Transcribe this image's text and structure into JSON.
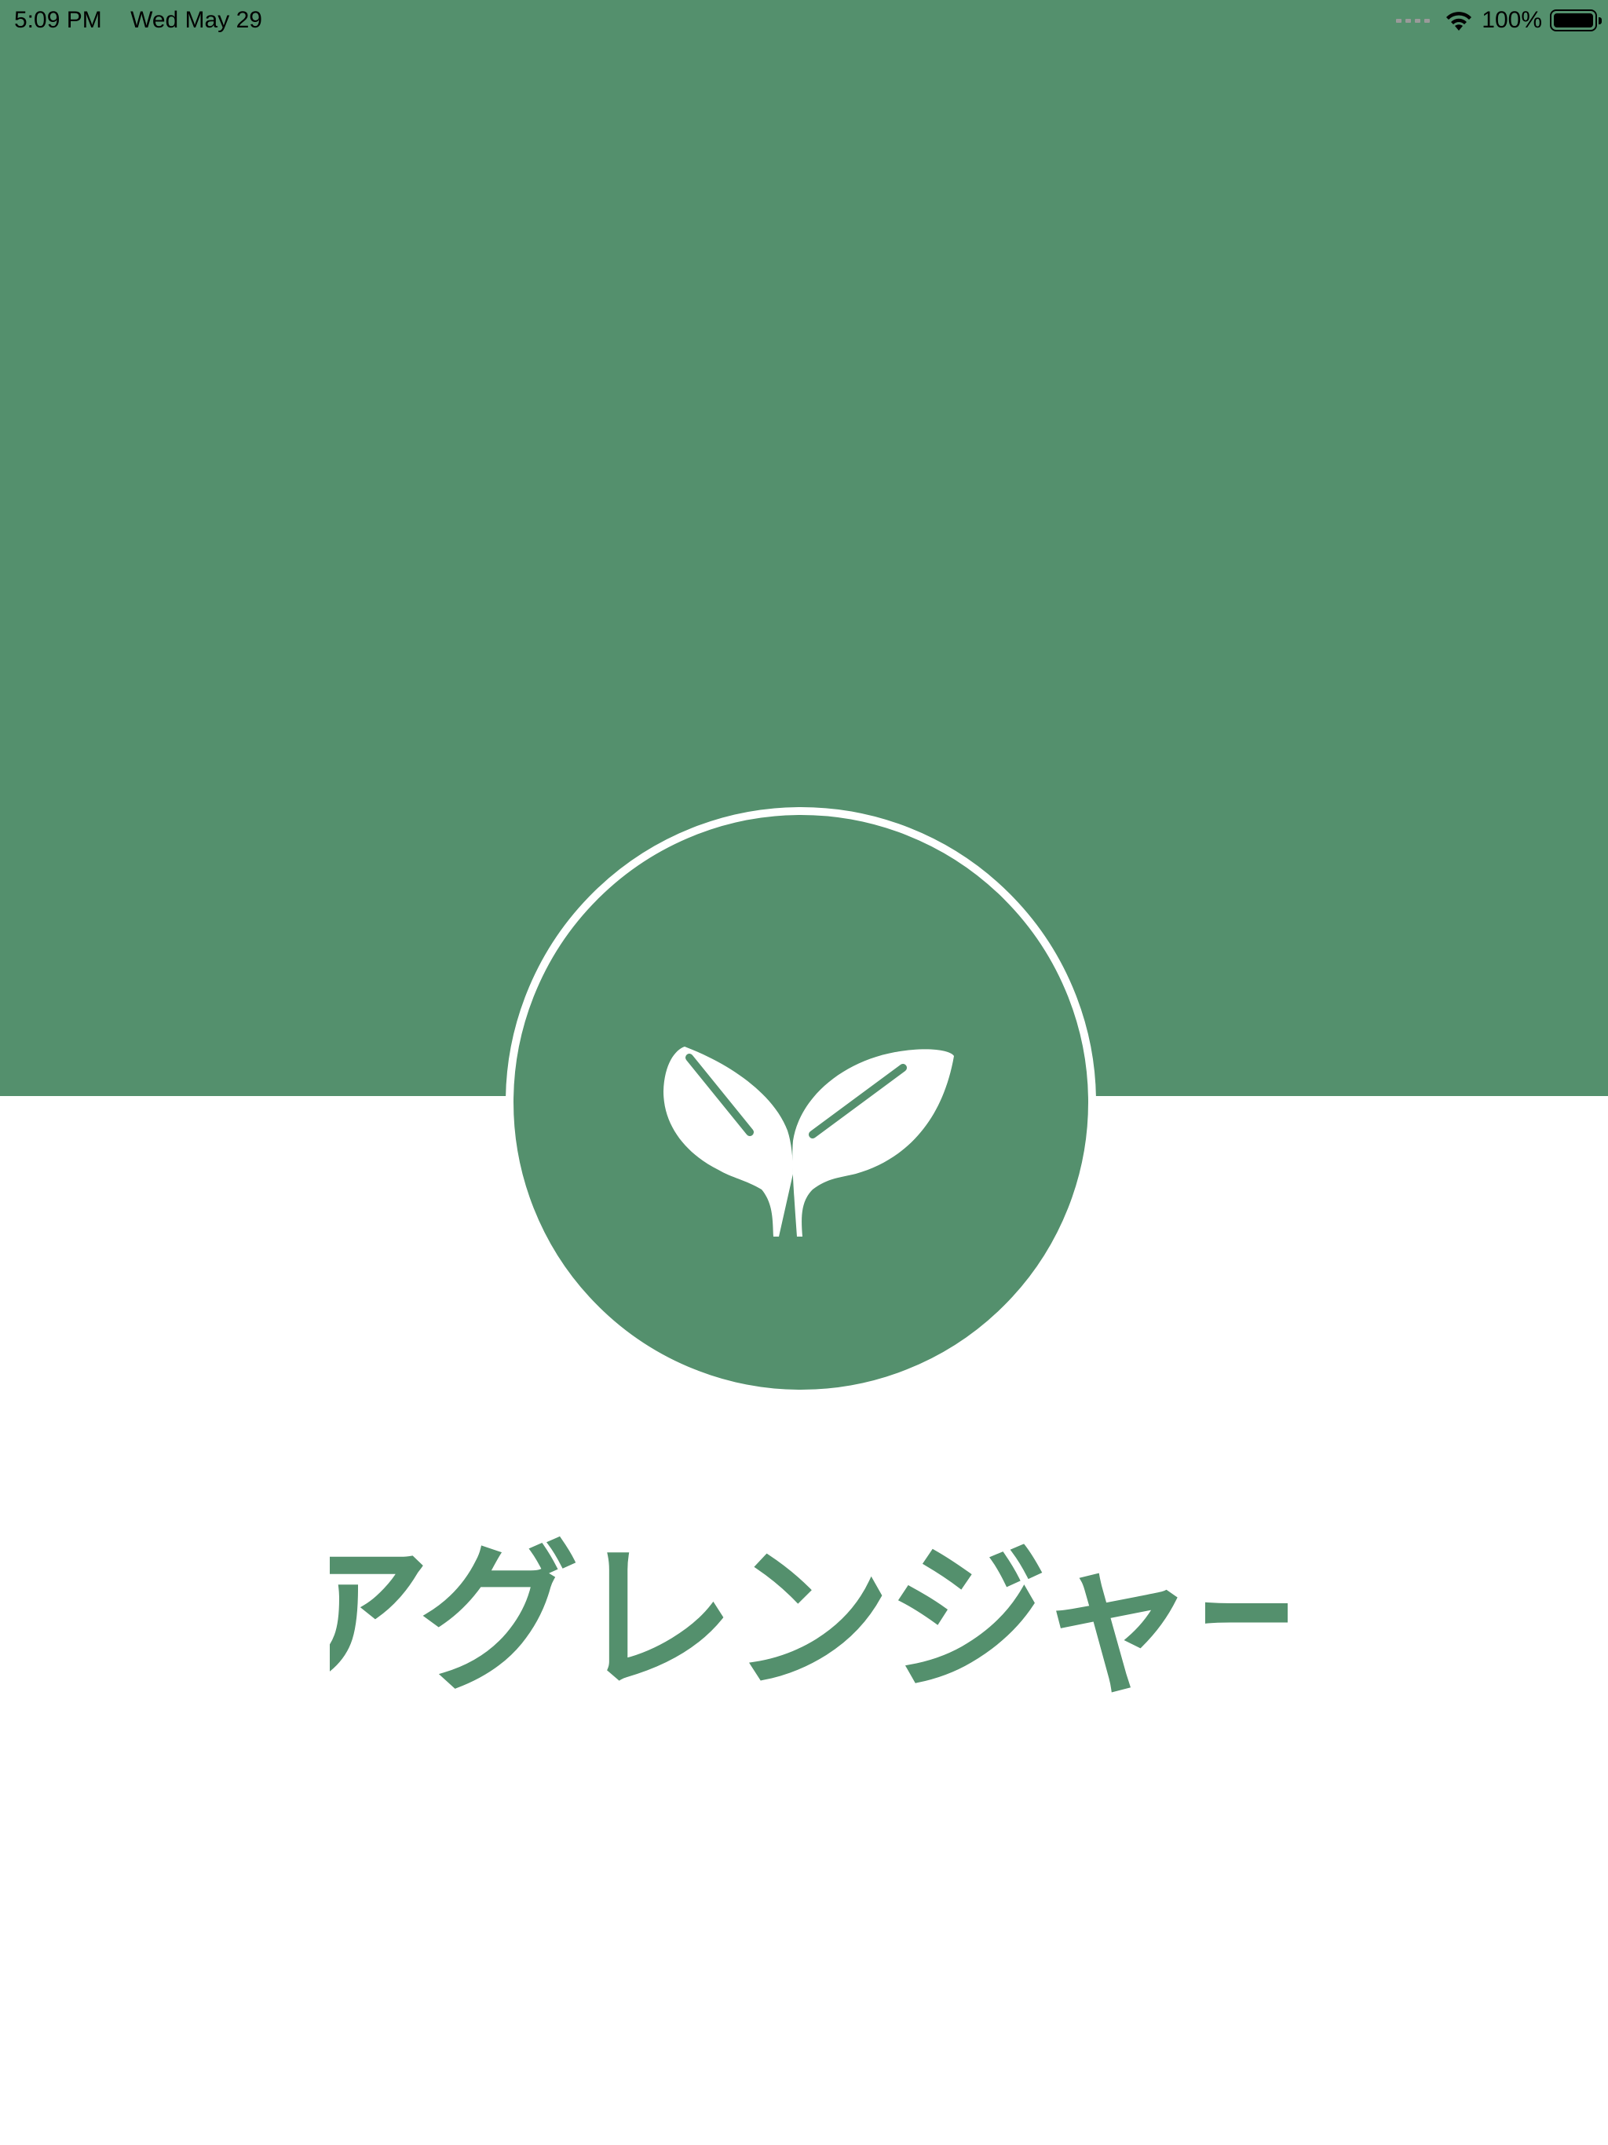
{
  "status_bar": {
    "time": "5:09 PM",
    "date": "Wed May 29",
    "battery_percent": "100%",
    "battery_level": 1.0,
    "icons": [
      "cellular-signal-icon",
      "wifi-icon",
      "battery-icon"
    ]
  },
  "colors": {
    "brand_green": "#54906D",
    "background": "#FFFFFF",
    "foreground": "#FFFFFF",
    "status_text": "#000000",
    "signal_dots": "#9A9A9A"
  },
  "logo": {
    "icon": "sprout-icon"
  },
  "wordmark": {
    "text": "アグレンジャー"
  }
}
